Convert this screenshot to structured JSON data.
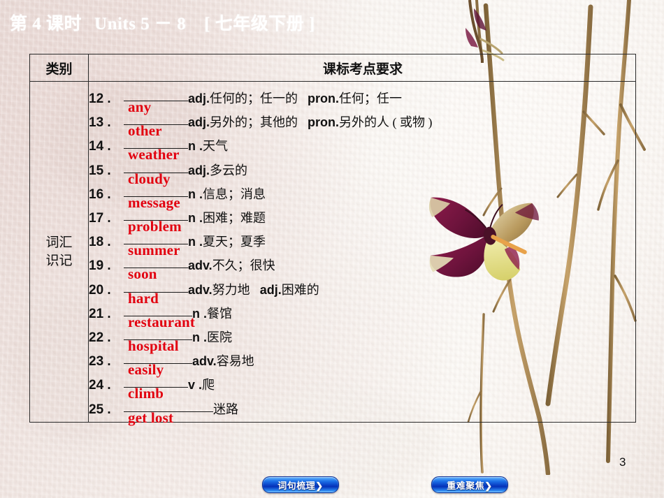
{
  "header": {
    "lesson": "第 4 课时",
    "units": "Units 5 － 8",
    "grade": "[ 七年级下册 ]"
  },
  "table": {
    "columns": [
      "类别",
      "课标考点要求"
    ],
    "category_label_line1": "词汇",
    "category_label_line2": "识记",
    "entries": [
      {
        "num": "12 .",
        "answer": "any",
        "blank_width": 92,
        "definition_pos": "adj.",
        "definition_cn": "任何的；任一的",
        "definition_pos2": "pron.",
        "definition_cn2": "任何；任一"
      },
      {
        "num": "13 .",
        "answer": "other",
        "blank_width": 92,
        "definition_pos": "adj.",
        "definition_cn": "另外的；其他的",
        "definition_pos2": "pron.",
        "definition_cn2": "另外的人 ( 或物 )"
      },
      {
        "num": "14 .",
        "answer": "weather",
        "blank_width": 92,
        "definition_pos": "n .",
        "definition_cn": "天气",
        "definition_pos2": "",
        "definition_cn2": ""
      },
      {
        "num": "15 .",
        "answer": "cloudy",
        "blank_width": 92,
        "definition_pos": "adj.",
        "definition_cn": "多云的",
        "definition_pos2": "",
        "definition_cn2": ""
      },
      {
        "num": "16 .",
        "answer": "message",
        "blank_width": 92,
        "definition_pos": "n .",
        "definition_cn": "信息；消息",
        "definition_pos2": "",
        "definition_cn2": ""
      },
      {
        "num": "17 .",
        "answer": "problem",
        "blank_width": 92,
        "definition_pos": "n .",
        "definition_cn": "困难；难题",
        "definition_pos2": "",
        "definition_cn2": ""
      },
      {
        "num": "18 .",
        "answer": "summer",
        "blank_width": 92,
        "definition_pos": "n .",
        "definition_cn": "夏天；夏季",
        "definition_pos2": "",
        "definition_cn2": ""
      },
      {
        "num": "19 .",
        "answer": "soon",
        "blank_width": 92,
        "definition_pos": "adv.",
        "definition_cn": "不久；很快",
        "definition_pos2": "",
        "definition_cn2": ""
      },
      {
        "num": "20 .",
        "answer": "hard",
        "blank_width": 92,
        "definition_pos": "adv.",
        "definition_cn": "努力地",
        "definition_pos2": "adj.",
        "definition_cn2": "困难的"
      },
      {
        "num": "21 .",
        "answer": "restaurant",
        "blank_width": 98,
        "definition_pos": "n .",
        "definition_cn": "餐馆",
        "definition_pos2": "",
        "definition_cn2": ""
      },
      {
        "num": "22 .",
        "answer": "hospital",
        "blank_width": 98,
        "definition_pos": "n .",
        "definition_cn": "医院",
        "definition_pos2": "",
        "definition_cn2": ""
      },
      {
        "num": "23 .",
        "answer": "easily",
        "blank_width": 98,
        "definition_pos": "adv.",
        "definition_cn": "容易地",
        "definition_pos2": "",
        "definition_cn2": ""
      },
      {
        "num": "24 .",
        "answer": "climb",
        "blank_width": 92,
        "definition_pos": "v .",
        "definition_cn": "爬",
        "definition_pos2": "",
        "definition_cn2": ""
      },
      {
        "num": "25 .",
        "answer": "get lost",
        "blank_width": 128,
        "definition_pos": "",
        "definition_cn": "迷路",
        "definition_pos2": "",
        "definition_cn2": ""
      }
    ]
  },
  "footer": {
    "left_button": "词句梳理❯",
    "right_button": "重难聚焦❯",
    "page_number": "3"
  },
  "colors": {
    "answer_red": "#e2000f",
    "button_blue": "#0530b8",
    "ink": "#1a1a1a",
    "paper": "#f7f1ec"
  }
}
